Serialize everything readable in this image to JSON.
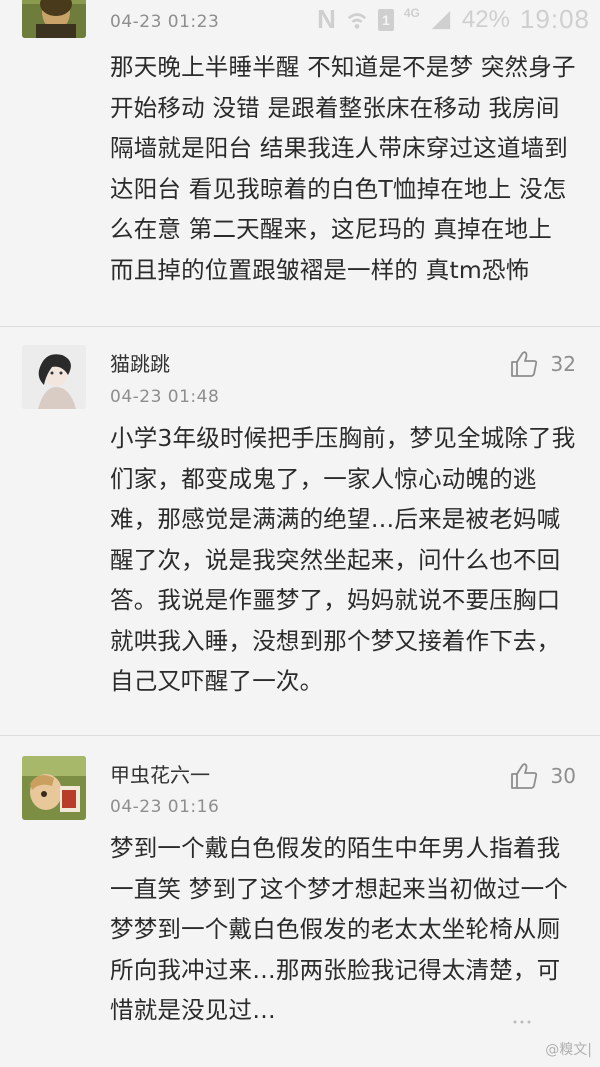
{
  "status_bar": {
    "network_letter": "N",
    "sim": "1",
    "network_type": "4G",
    "battery": "42%",
    "time": "19:08"
  },
  "comments": [
    {
      "time": "04-23 01:23",
      "text": "那天晚上半睡半醒 不知道是不是梦 突然身子开始移动 没错 是跟着整张床在移动 我房间隔墙就是阳台 结果我连人带床穿过这道墙到达阳台 看见我晾着的白色T恤掉在地上 没怎么在意 第二天醒来，这尼玛的 真掉在地上 而且掉的位置跟皱褶是一样的 真tm恐怖"
    },
    {
      "author": "猫跳跳",
      "time": "04-23 01:48",
      "likes": "32",
      "text": "小学3年级时候把手压胸前，梦见全城除了我们家，都变成鬼了，一家人惊心动魄的逃难，那感觉是满满的绝望…后来是被老妈喊醒了次，说是我突然坐起来，问什么也不回答。我说是作噩梦了，妈妈就说不要压胸口就哄我入睡，没想到那个梦又接着作下去，自己又吓醒了一次。"
    },
    {
      "author": "甲虫花六一",
      "time": "04-23 01:16",
      "likes": "30",
      "text": "梦到一个戴白色假发的陌生中年男人指着我一直笑 梦到了这个梦才想起来当初做过一个梦梦到一个戴白色假发的老太太坐轮椅从厕所向我冲过来…那两张脸我记得太清楚，可惜就是没见过…"
    }
  ],
  "watermark": "@糗文|"
}
